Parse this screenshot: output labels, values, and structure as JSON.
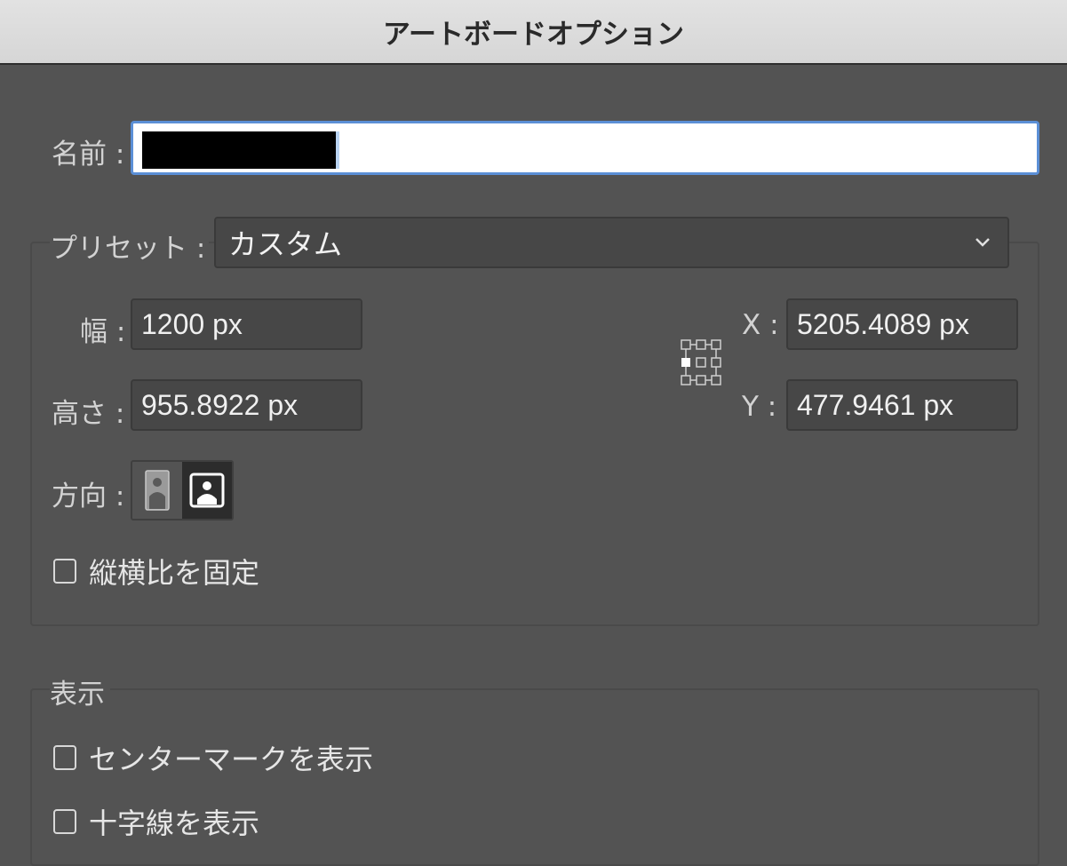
{
  "window": {
    "title": "アートボードオプション"
  },
  "name": {
    "label": "名前 :",
    "value": ""
  },
  "preset": {
    "label": "プリセット :",
    "selected": "カスタム",
    "chevron_icon": "chevron-down-icon"
  },
  "dimensions": {
    "width_label": "幅 :",
    "width_value": "1200 px",
    "height_label": "高さ :",
    "height_value": "955.8922 px",
    "x_label": "X :",
    "x_value": "5205.4089 px",
    "y_label": "Y :",
    "y_value": "477.9461 px"
  },
  "orientation": {
    "label": "方向 :",
    "portrait_icon": "portrait-icon",
    "landscape_icon": "landscape-icon",
    "selected": "landscape"
  },
  "constrain": {
    "label": "縦横比を固定",
    "checked": false
  },
  "display": {
    "heading": "表示",
    "center_mark": {
      "label": "センターマークを表示",
      "checked": false
    },
    "cross_hairs": {
      "label": "十字線を表示",
      "checked": false
    }
  },
  "colors": {
    "background": "#535353",
    "titlebar": "#dcdcdc",
    "field_bg": "#474747",
    "focus_ring": "#5b8fd6",
    "text": "#d2d2d2"
  }
}
